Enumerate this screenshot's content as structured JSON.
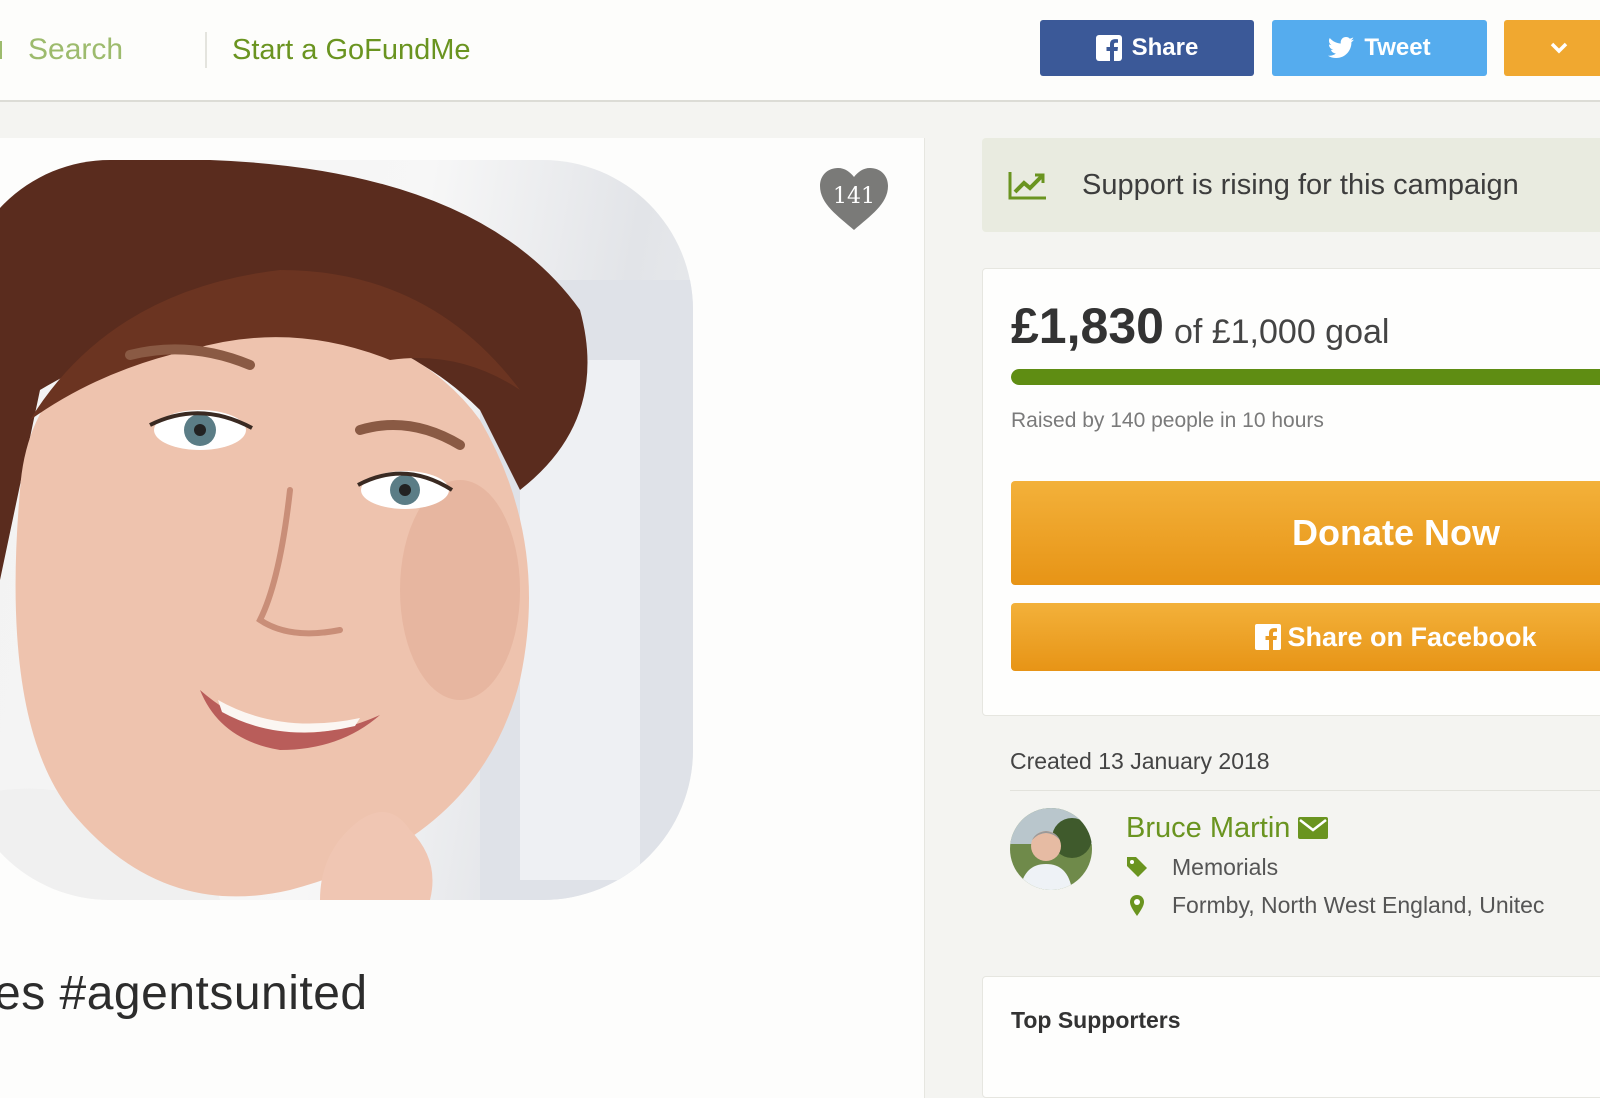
{
  "header": {
    "search_label": "Search",
    "start_label": "Start a GoFundMe",
    "share_label": "Share",
    "tweet_label": "Tweet"
  },
  "campaign": {
    "title_partial": "es #agentsunited",
    "hearts": "141"
  },
  "sidebar": {
    "rising_text": "Support is rising for this campaign",
    "amount_raised": "£1,830",
    "goal_text": "of £1,000 goal",
    "progress_fraction": 1.0,
    "raised_by_text": "Raised by 140 people in 10 hours",
    "donate_label": "Donate Now",
    "share_facebook_label": "Share on Facebook",
    "created_text": "Created 13 January 2018",
    "organizer_name": "Bruce Martin",
    "category": "Memorials",
    "location": "Formby, North West England, Unitec",
    "top_supporters_title": "Top Supporters"
  },
  "colors": {
    "brand_green": "#6a9420",
    "progress_green": "#5f8d13",
    "donate_orange": "#f0a830",
    "facebook_blue": "#3b5998",
    "twitter_blue": "#55acee"
  },
  "icons": {
    "search": "search-icon",
    "facebook": "facebook-icon",
    "twitter": "twitter-icon",
    "heart": "heart-icon",
    "trend": "trend-up-icon",
    "mail": "mail-icon",
    "tag": "tag-icon",
    "location": "map-pin-icon"
  }
}
